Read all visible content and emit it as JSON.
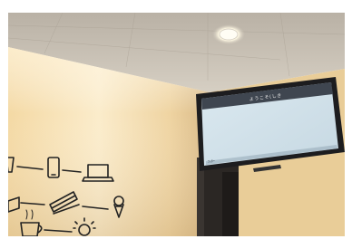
{
  "scene": {
    "colors": {
      "ceiling": "#c9c2b6",
      "wall_lit": "#f6e0b0",
      "wall_shadow": "#c8a97a",
      "pillar": "#2a2622",
      "tv_frame": "#1d1d1f",
      "tv_screen": "#d4e4ec",
      "tv_header_bar": "#3f4650",
      "mural_line": "#222222",
      "downlight": "#fffdf4"
    },
    "screen": {
      "header_text": "ようこそ(しき",
      "footer_text": "ﾌｯﾀｰ"
    },
    "mural_icons": [
      "cup-icon",
      "smartphone-icon",
      "laptop-icon",
      "book-icon",
      "sandwich-icon",
      "ice-cream-icon",
      "coffee-cup-icon",
      "lightbulb-icon"
    ]
  }
}
